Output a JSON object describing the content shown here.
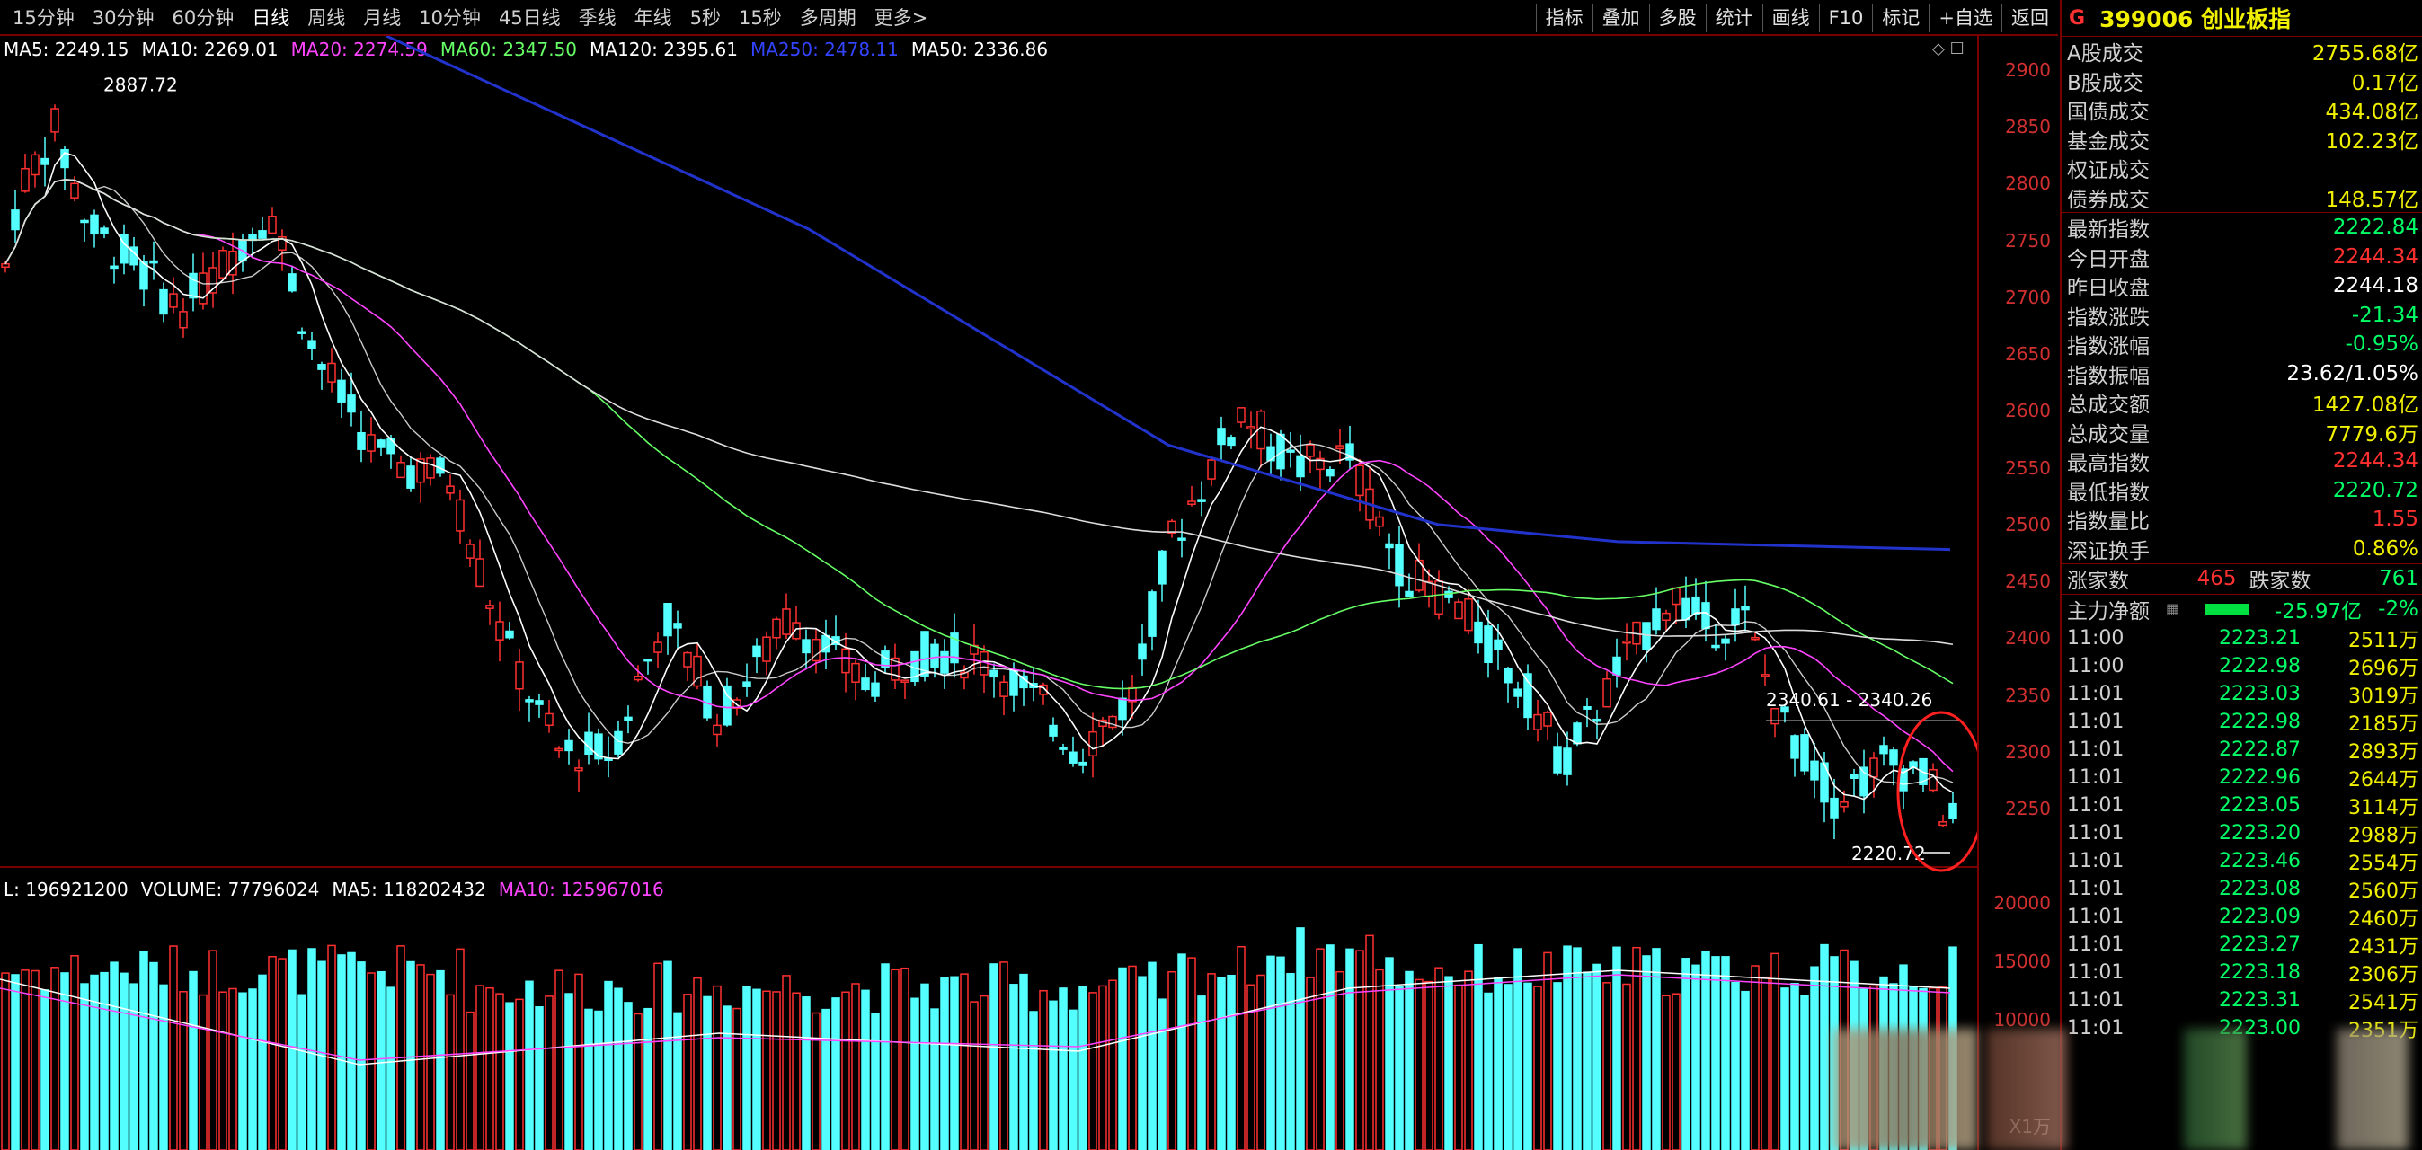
{
  "toolbar": {
    "periods": [
      "15分钟",
      "30分钟",
      "60分钟",
      "日线",
      "周线",
      "月线",
      "10分钟",
      "45日线",
      "季线",
      "年线",
      "5秒",
      "15秒",
      "多周期",
      "更多>"
    ],
    "tools": [
      "指标",
      "叠加",
      "多股",
      "统计",
      "画线",
      "F10",
      "标记",
      "+自选",
      "返回"
    ]
  },
  "indicators": [
    {
      "text": "MA5: 2249.15",
      "color": "#ffffff"
    },
    {
      "text": "MA10: 2269.01",
      "color": "#ffffff"
    },
    {
      "text": "MA20: 2274.59",
      "color": "#ff44ff"
    },
    {
      "text": "MA60: 2347.50",
      "color": "#66ff66"
    },
    {
      "text": "MA120: 2395.61",
      "color": "#ffffff"
    },
    {
      "text": "MA250: 2478.11",
      "color": "#3344ff"
    },
    {
      "text": "MA50: 2336.86",
      "color": "#ffffff"
    }
  ],
  "volume_indicators": [
    {
      "text": "L: 196921200",
      "color": "#ffffff"
    },
    {
      "text": "VOLUME: 77796024",
      "color": "#ffffff"
    },
    {
      "text": "MA5: 118202432",
      "color": "#ffffff"
    },
    {
      "text": "MA10: 125967016",
      "color": "#ff44ff"
    }
  ],
  "chart_data": {
    "type": "candlestick",
    "price_axis": [
      2250,
      2300,
      2350,
      2400,
      2450,
      2500,
      2550,
      2600,
      2650,
      2700,
      2750,
      2800,
      2850,
      2900
    ],
    "volume_axis": [
      10000,
      15000,
      20000
    ],
    "volume_unit": "X1万",
    "annotations": {
      "high": "2887.72",
      "low": "2220.72",
      "level": "2340.61 - 2340.26"
    }
  },
  "panel": {
    "code_prefix": "G",
    "title": "399006 创业板指",
    "market": [
      {
        "label": "A股成交",
        "value": "2755.68亿",
        "cls": "yellow"
      },
      {
        "label": "B股成交",
        "value": "0.17亿",
        "cls": "yellow"
      },
      {
        "label": "国债成交",
        "value": "434.08亿",
        "cls": "yellow"
      },
      {
        "label": "基金成交",
        "value": "102.23亿",
        "cls": "yellow"
      },
      {
        "label": "权证成交",
        "value": "",
        "cls": "yellow"
      },
      {
        "label": "债券成交",
        "value": "148.57亿",
        "cls": "yellow"
      }
    ],
    "quote": [
      {
        "label": "最新指数",
        "value": "2222.84",
        "cls": "green"
      },
      {
        "label": "今日开盘",
        "value": "2244.34",
        "cls": "red"
      },
      {
        "label": "昨日收盘",
        "value": "2244.18",
        "cls": "white"
      },
      {
        "label": "指数涨跌",
        "value": "-21.34",
        "cls": "green"
      },
      {
        "label": "指数涨幅",
        "value": "-0.95%",
        "cls": "green"
      },
      {
        "label": "指数振幅",
        "value": "23.62/1.05%",
        "cls": "white"
      },
      {
        "label": "总成交额",
        "value": "1427.08亿",
        "cls": "yellow"
      },
      {
        "label": "总成交量",
        "value": "7779.6万",
        "cls": "yellow"
      },
      {
        "label": "最高指数",
        "value": "2244.34",
        "cls": "red"
      },
      {
        "label": "最低指数",
        "value": "2220.72",
        "cls": "green"
      },
      {
        "label": "指数量比",
        "value": "1.55",
        "cls": "red"
      },
      {
        "label": "深证换手",
        "value": "0.86%",
        "cls": "yellow"
      }
    ],
    "breadth": {
      "up_label": "涨家数",
      "up": "465",
      "down_label": "跌家数",
      "down": "761"
    },
    "mainflow": {
      "label": "主力净额",
      "value": "-25.97亿",
      "pct": "-2%"
    },
    "ticks": [
      {
        "t": "11:00",
        "p": "2223.21",
        "v": "2511万"
      },
      {
        "t": "11:00",
        "p": "2222.98",
        "v": "2696万"
      },
      {
        "t": "11:01",
        "p": "2223.03",
        "v": "3019万"
      },
      {
        "t": "11:01",
        "p": "2222.98",
        "v": "2185万"
      },
      {
        "t": "11:01",
        "p": "2222.87",
        "v": "2893万"
      },
      {
        "t": "11:01",
        "p": "2222.96",
        "v": "2644万"
      },
      {
        "t": "11:01",
        "p": "2223.05",
        "v": "3114万"
      },
      {
        "t": "11:01",
        "p": "2223.20",
        "v": "2988万"
      },
      {
        "t": "11:01",
        "p": "2223.46",
        "v": "2554万"
      },
      {
        "t": "11:01",
        "p": "2223.08",
        "v": "2560万"
      },
      {
        "t": "11:01",
        "p": "2223.09",
        "v": "2460万"
      },
      {
        "t": "11:01",
        "p": "2223.27",
        "v": "2431万"
      },
      {
        "t": "11:01",
        "p": "2223.18",
        "v": "2306万"
      },
      {
        "t": "11:01",
        "p": "2223.31",
        "v": "2541万"
      },
      {
        "t": "11:01",
        "p": "2223.00",
        "v": "2351万"
      }
    ]
  }
}
